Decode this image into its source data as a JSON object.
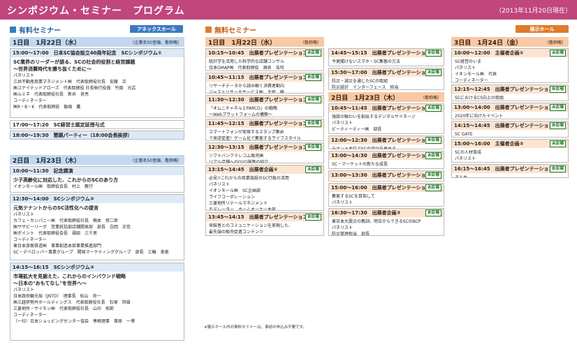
{
  "header": {
    "title": "シンポジウム・セミナー　プログラム",
    "date": "（2013年11月20日現在）"
  },
  "paid": {
    "label": "有料セミナー",
    "hall": "アネックスホール",
    "accent": "#3a7abf"
  },
  "free": {
    "label": "無料セミナー",
    "hall": "展示ホール",
    "accent": "#e07b2a"
  },
  "days": {
    "d1p": {
      "title": "1日目　1月22日（水）",
      "note": "（企業名50音順、敬称略）"
    },
    "d2p": {
      "title": "2日目　1月23日（木）",
      "note": "（企業名50音順、敬称略）"
    },
    "d1f": {
      "title": "1日目　1月22日（水）",
      "note": "（敬称略）"
    },
    "d2f": {
      "title": "2日目　1月23日（木）",
      "note": "（敬称略）"
    },
    "d3f": {
      "title": "3日目　1月24日（金）",
      "note": "（敬称略）"
    }
  },
  "events": {
    "p1": {
      "time": "15:00〜17:00　日本SC協会設立40周年記念　SCシンポジウム①",
      "title": "SC業界のリーダーが語る、SCの社会的役割と経営課題",
      "sub": "〜世界消費時代を勝ち抜くために〜",
      "body": [
        "パネリスト",
        "三井不動産商業マネジメント㈱　代表取締役社長　安藤　正",
        "㈱ユナイテッドアローズ　代表取締役 社長執行役員　竹田　光広",
        "㈱ルミネ　代表取締役社長　新井　良亮",
        "コーディネーター",
        "㈱R・B・K　代表取締役　飯嶋　薫"
      ]
    },
    "p2": {
      "time": "17:00〜17:20　SC経営士認定証授与式"
    },
    "p3": {
      "time": "18:00〜19:30　懇親パーティー（18:00会長挨拶）"
    },
    "p4": {
      "time": "10:00〜11:30　記念講演",
      "title": "少子高齢化に対応した、これからのSCのあり方",
      "body": [
        "イオンモール㈱　取締役会長　村上　教行"
      ]
    },
    "p5": {
      "time": "12:30〜14:00　SCシンポジウム②",
      "title": "元気テナントからのSC活性化への提言",
      "body": [
        "パネリスト",
        "カフェ・カンパニー㈱　代表取締役社長　楠本　修二郎",
        "㈱サザビーリーグ　営業統括部店舗開発部　部長　白岡　正信",
        "㈱ポイント　代表取締役会長　福田　三千男",
        "コーディネーター",
        "東日本旅客鉄道㈱　事業創造本部事業推進部門",
        "SC・デベロッパー事業グループ　開発マーケティンググループ　部長　三輪　美恵"
      ]
    },
    "p6": {
      "time": "14:15〜16:15　SCシンポジウム③",
      "title": "市場拡大を見据えた、これからのインバウンド戦略",
      "sub": "〜日本の\"おもてなし\"を世界へ〜",
      "body": [
        "パネリスト",
        "日本政府観光局（JNTO）　理事長　松山　良一",
        "㈱三越伊勢丹ホールディングス　代表取締役社長　石塚　邦雄",
        "三菱地所・サイモン㈱　代表取締役社長　山中　拓郎",
        "コーディネーター",
        "（一社）日本ショッピングセンター協会　専務理事　篠原　一博"
      ]
    },
    "f1": {
      "time": "10:15〜10:45　出展者プレゼンテーション①",
      "room": "A会場",
      "body": [
        "統計学を活用した科学的な店舗コンサル",
        "日本GMAP㈱　代表取締役　酒井　浩司"
      ]
    },
    "f2": {
      "time": "10:45〜11:15　出展者プレゼンテーション②",
      "room": "B会場",
      "body": [
        "リサーチデータから読み解く消費者動向",
        "ジャストリサーチサービス㈱　大庭　務"
      ]
    },
    "f3": {
      "time": "11:30〜12:30　出展者プレゼンテーション③",
      "room": "A会場",
      "body": [
        "「オムニチャネルとPARCO」の戦略",
        "〜Webプラットフォームの構築〜",
        "㈱パルコ　WEB事業部　部長　林　直孝"
      ]
    },
    "f4": {
      "time": "11:45〜12:15　出展者プレゼンテーション④",
      "room": "B会場",
      "body": [
        "スマートフォンが実現するスタンプ集め",
        "で来店促進！ゲーム化で集客するライフスタイル",
        "キャスティングネット"
      ]
    },
    "f5": {
      "time": "12:30〜13:15　出展者プレゼンテーション⑤",
      "room": "B会場",
      "body": [
        "ソフトバンクテレコム販売㈱",
        "リアル店舗へのO2O施策の紹介",
        "パートナー営業本部　森　誠"
      ]
    },
    "f6": {
      "time": "13:15〜14:45　出展者企画①",
      "room": "A会場",
      "body": [
        "必見!!これからの商業施設のSC行政の活用",
        "パネリスト",
        "イオンモール㈱　SC企画部",
        "ライフコーポレーション",
        "三菱地所リテールマネジメント",
        "モデレーター　ホームオーナー本部"
      ]
    },
    "f7": {
      "time": "13:45〜14:15　出展者プレゼンテーション⑥",
      "room": "B会場",
      "body": [
        "来館者とのコミュニケーションを実現した、",
        "最先端の販売促進コンテンツ",
        "グリーンコミュニケーションズ　部長"
      ]
    },
    "f8": {
      "time": "14:45〜15:15　出展者プレゼンテーション⑦",
      "room": "B会場",
      "body": [
        "今更聞けないスマホ・SC集客の方法",
        "マーケットデザインアソシエイト",
        "Webディレクター"
      ]
    },
    "f9": {
      "time": "15:30〜17:00　出展者プレゼンテーション⑧",
      "room": "A会場",
      "body": [
        "防災・減災を通じたSCの取組",
        "防災設計　インターフェース　担当"
      ]
    },
    "f10": {
      "time": "10:45〜11:45　出展者プレゼンテーション⑨",
      "room": "A会場",
      "body": [
        "施設の賑わいを創出するデジタルサイネージ",
        "パネリスト",
        "ビーティーディー㈱　部長",
        "丸紅アクセスソリューションズ"
      ]
    },
    "f11": {
      "time": "12:00〜12:30　出展者プレゼンテーション⑩",
      "room": "B会場",
      "body": [
        "テナント本位でSCの収益を高める",
        "ワークスアプリケーションズ　鈴木　理貴"
      ]
    },
    "f12": {
      "time": "13:00〜14:30　出展者プレゼンテーション⑪",
      "room": "A会場",
      "body": [
        "SC・マーケットの新たな成長",
        "ディライトマーケティング",
        "部長"
      ]
    },
    "f13": {
      "time": "13:00〜13:30　出展者プレゼンテーション⑫",
      "room": "B会場",
      "body": [
        "SCマーケティング最前線",
        "代表　鈴木"
      ]
    },
    "f14": {
      "time": "15:00〜16:00　出展者プレゼンテーション⑬",
      "room": "A会場",
      "body": [
        "集客するSCを目指して",
        "パネリスト",
        "㈱ipoca　代表取締役",
        "㈱トランス・コスモス",
        "Webディレクター"
      ]
    },
    "f15": {
      "time": "16:30〜17:30　出展者企画②",
      "room": "B会場",
      "body": [
        "東日本大震災の教訓、明日からできるSCのBCP",
        "パネリスト",
        "防災管理担当　部長",
        "鈴木"
      ]
    },
    "f16": {
      "time": "10:00〜12:00　主催者企画①",
      "room": "A会場",
      "body": [
        "SC経営のいま",
        "パネリスト",
        "イオンモール㈱　代表",
        "コーディネーター"
      ]
    },
    "f17": {
      "time": "12:15〜12:45　出展者プレゼンテーション⑭",
      "room": "B会場",
      "body": [
        "SCにおけるCS向上の取組",
        "パネリスト"
      ]
    },
    "f18": {
      "time": "13:00〜14:00　出展者プレゼンテーション⑮",
      "room": "A会場",
      "body": [
        "2020年に向けたイベント",
        "パネリスト"
      ]
    },
    "f19": {
      "time": "14:15〜14:45　出展者プレゼンテーション⑯",
      "room": "B会場",
      "body": [
        "SC GATE",
        "代表"
      ]
    },
    "f20": {
      "time": "15:00〜16:00　主催者企画②",
      "room": "A会場",
      "body": [
        "SCの人材育成",
        "パネリスト",
        "コーディネーター"
      ]
    },
    "f21": {
      "time": "16:15〜16:45　出展者プレゼンテーション⑰",
      "room": "B会場",
      "body": [
        "まとめ"
      ]
    }
  },
  "footnote": "※展示ホール内の無料セミナーは、事前の申込み不要です。"
}
